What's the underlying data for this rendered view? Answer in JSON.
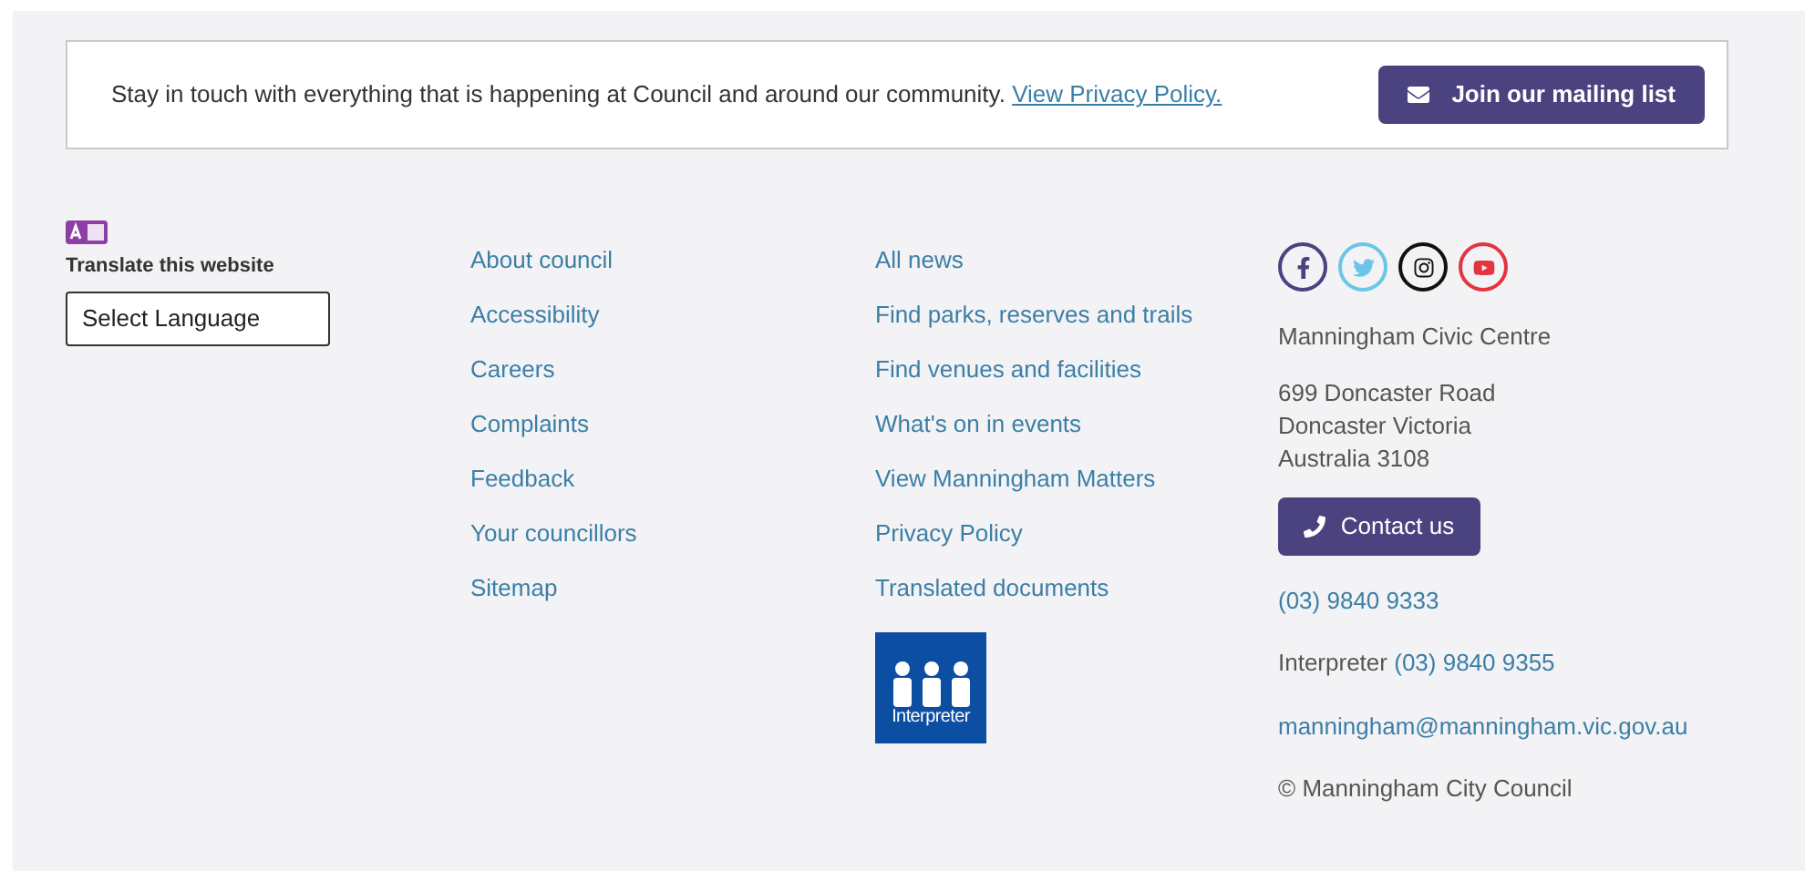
{
  "newsletter": {
    "text": "Stay in touch with everything that is happening at Council and around our community.",
    "privacy_link": "View Privacy Policy.",
    "button": "Join our mailing list"
  },
  "translate": {
    "label": "Translate this website",
    "select_value": "Select Language"
  },
  "links_1": [
    "About council",
    "Accessibility",
    "Careers",
    "Complaints",
    "Feedback",
    "Your councillors",
    "Sitemap"
  ],
  "links_2": [
    "All news",
    "Find parks, reserves and trails",
    "Find venues and facilities",
    "What's on in events",
    "View Manningham Matters",
    "Privacy Policy",
    "Translated documents"
  ],
  "interpreter_logo": {
    "text": "Interpreter"
  },
  "social": [
    {
      "kind": "facebook",
      "color": "#4b4280"
    },
    {
      "kind": "twitter",
      "color": "#6cc5e6"
    },
    {
      "kind": "instagram",
      "color": "#111111"
    },
    {
      "kind": "youtube",
      "color": "#e3343f"
    }
  ],
  "contact": {
    "name": "Manningham Civic Centre",
    "address": [
      "699 Doncaster Road",
      "Doncaster Victoria",
      "Australia 3108"
    ],
    "button": "Contact us",
    "phone": "(03) 9840 9333",
    "interpreter_label": "Interpreter",
    "interpreter_phone": "(03) 9840 9355",
    "email": "manningham@manningham.vic.gov.au",
    "copyright": "© Manningham City Council"
  }
}
